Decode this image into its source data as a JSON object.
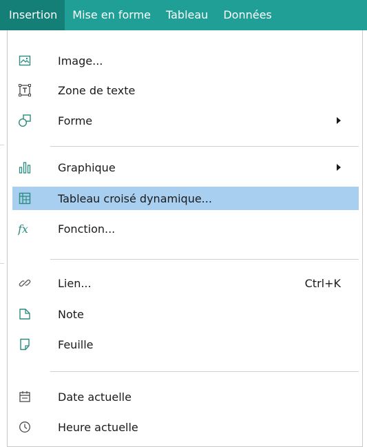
{
  "menubar": {
    "items": [
      {
        "label": "Insertion"
      },
      {
        "label": "Mise en forme"
      },
      {
        "label": "Tableau"
      },
      {
        "label": "Données"
      }
    ]
  },
  "menu": {
    "items": [
      {
        "label": "Image...",
        "icon": "image-icon"
      },
      {
        "label": "Zone de texte",
        "icon": "text-box-icon"
      },
      {
        "label": "Forme",
        "icon": "shape-icon",
        "submenu": true
      },
      {
        "label": "Graphique",
        "icon": "chart-icon",
        "submenu": true
      },
      {
        "label": "Tableau croisé dynamique...",
        "icon": "pivot-table-icon",
        "highlighted": true
      },
      {
        "label": "Fonction...",
        "icon": "function-icon"
      },
      {
        "label": "Lien...",
        "icon": "link-icon",
        "shortcut": "Ctrl+K"
      },
      {
        "label": "Note",
        "icon": "note-icon"
      },
      {
        "label": "Feuille",
        "icon": "sheet-icon"
      },
      {
        "label": "Date actuelle",
        "icon": "calendar-icon"
      },
      {
        "label": "Heure actuelle",
        "icon": "clock-icon"
      }
    ]
  },
  "colors": {
    "menubar_bg": "#1f9f95",
    "menubar_active": "#137f76",
    "highlight": "#a8cff0",
    "icon_teal": "#2a8a7e"
  }
}
